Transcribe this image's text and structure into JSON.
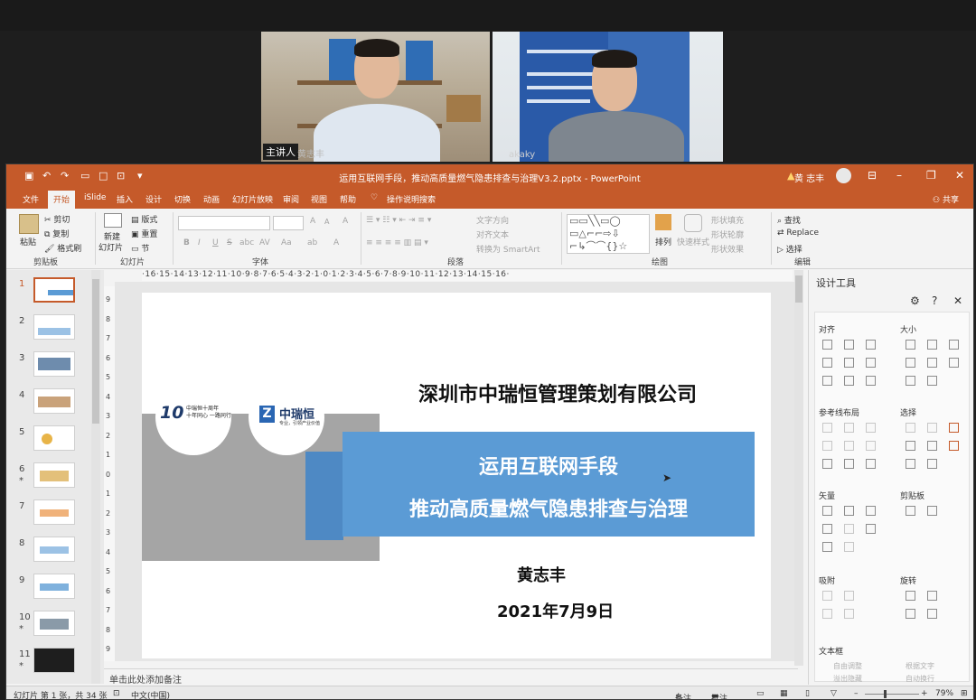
{
  "videos": [
    {
      "name_tag": "主讲人",
      "name_extra": "黄志丰"
    },
    {
      "name_extra": "akaky"
    }
  ],
  "window": {
    "title": "运用互联网手段，推动高质量燃气隐患排查与治理V3.2.pptx - PowerPoint",
    "user": "黄 志丰",
    "warning_icon": "warning-icon"
  },
  "tabs": [
    "文件",
    "开始",
    "iSlide",
    "插入",
    "设计",
    "切换",
    "动画",
    "幻灯片放映",
    "审阅",
    "视图",
    "帮助",
    "操作说明搜索"
  ],
  "active_tab": "开始",
  "share_label": "共享",
  "ribbon": {
    "clipboard": {
      "paste": "粘贴",
      "cut": "剪切",
      "copy": "复制",
      "format_painter": "格式刷",
      "label": "剪贴板"
    },
    "slides": {
      "new_slide": "新建",
      "new_slide2": "幻灯片",
      "layout": "版式",
      "reset": "重置",
      "section": "节",
      "label": "幻灯片"
    },
    "font": {
      "bold": "B",
      "italic": "I",
      "underline": "U",
      "strike": "S",
      "shadow": "abc",
      "spacing": "AV",
      "case": "Aa",
      "clear": "A",
      "color": "A",
      "grow": "A",
      "shrink": "A",
      "label": "字体"
    },
    "paragraph": {
      "text_direction": "文字方向",
      "align_text": "对齐文本",
      "smartart": "转换为 SmartArt",
      "label": "段落"
    },
    "drawing": {
      "arrange": "排列",
      "quick_styles": "快速样式",
      "fill": "形状填充",
      "outline": "形状轮廓",
      "effects": "形状效果",
      "label": "绘图"
    },
    "editing": {
      "find": "查找",
      "replace": "Replace",
      "select": "选择",
      "label": "编辑"
    }
  },
  "thumbnails": [
    {
      "num": "1",
      "star": ""
    },
    {
      "num": "2",
      "star": ""
    },
    {
      "num": "3",
      "star": ""
    },
    {
      "num": "4",
      "star": ""
    },
    {
      "num": "5",
      "star": ""
    },
    {
      "num": "6",
      "star": "*"
    },
    {
      "num": "7",
      "star": ""
    },
    {
      "num": "8",
      "star": ""
    },
    {
      "num": "9",
      "star": ""
    },
    {
      "num": "10",
      "star": "*"
    },
    {
      "num": "11",
      "star": "*"
    }
  ],
  "ruler": {
    "h": "·16·15·14·13·12·11·10·9·8·7·6·5·4·3·2·1·0·1·2·3·4·5·6·7·8·9·10·11·12·13·14·15·16·",
    "v": [
      "9",
      "8",
      "7",
      "6",
      "5",
      "4",
      "3",
      "2",
      "1",
      "0",
      "1",
      "2",
      "3",
      "4",
      "5",
      "6",
      "7",
      "8",
      "9"
    ]
  },
  "slide": {
    "company": "深圳市中瑞恒管理策划有限公司",
    "title_line1": "运用互联网手段",
    "title_line2": "推动高质量燃气隐患排查与治理",
    "author": "黄志丰",
    "date": "2021年7月9日",
    "logo1_num": "10",
    "logo1_text1": "中瑞恒十周年",
    "logo1_text2": "十年同心 一路同行",
    "logo2_letter": "Z",
    "logo2_name": "中瑞恒",
    "logo2_sub": "专业，引领产业价值"
  },
  "notes_placeholder": "单击此处添加备注",
  "status": {
    "slide_info": "幻灯片 第 1 张，共 34 张",
    "language": "中文(中国)",
    "notes": "备注",
    "comments": "批注",
    "zoom": "79%"
  },
  "pane": {
    "title": "设计工具",
    "sections": [
      "对齐",
      "大小",
      "参考线布局",
      "选择",
      "矢量",
      "剪贴板",
      "吸附",
      "旋转",
      "文本框"
    ],
    "dim_items": [
      "自由调整",
      "根据文字",
      "溢出隐藏",
      "自动换行"
    ]
  }
}
